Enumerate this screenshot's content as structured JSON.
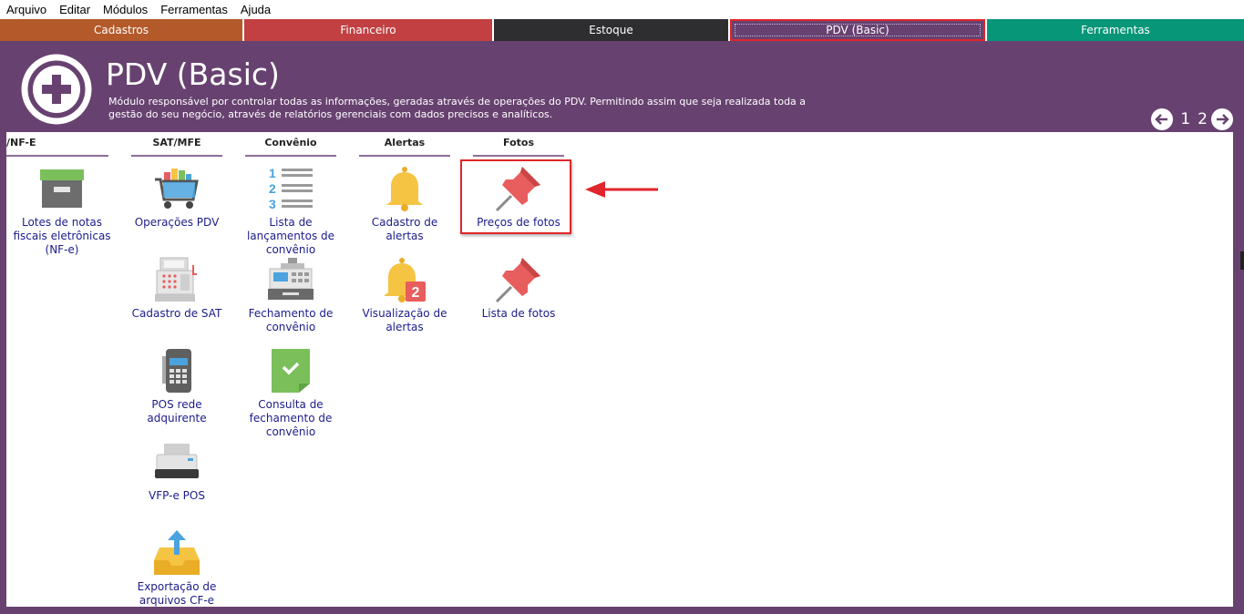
{
  "menu": [
    "Arquivo",
    "Editar",
    "Módulos",
    "Ferramentas",
    "Ajuda"
  ],
  "tabs": [
    {
      "label": "Cadastros",
      "color": "#b4592a"
    },
    {
      "label": "Financeiro",
      "color": "#c24042"
    },
    {
      "label": "Estoque",
      "color": "#2e2d2f"
    },
    {
      "label": "PDV (Basic)",
      "color": "#674270"
    },
    {
      "label": "Ferramentas",
      "color": "#079678"
    }
  ],
  "header": {
    "title": "PDV (Basic)",
    "description": "Módulo responsável por controlar todas as informações, geradas através de operações do PDV. Permitindo assim que seja realizada toda a gestão do seu negócio, através de relatórios gerenciais com dados precisos e analíticos.",
    "pages": [
      "1",
      "2"
    ]
  },
  "columns": [
    {
      "title": "/NF-E",
      "items": [
        "Lotes de notas fiscais eletrônicas (NF-e)"
      ]
    },
    {
      "title": "SAT/MFE",
      "items": [
        "Operações PDV",
        "Cadastro de SAT",
        "POS rede adquirente",
        "VFP-e POS",
        "Exportação de arquivos CF-e"
      ]
    },
    {
      "title": "Convênio",
      "items": [
        "Lista de lançamentos de convênio",
        "Fechamento de convênio",
        "Consulta de fechamento de convênio"
      ]
    },
    {
      "title": "Alertas",
      "items": [
        "Cadastro de alertas",
        "Visualização de alertas"
      ]
    },
    {
      "title": "Fotos",
      "items": [
        "Preços de fotos",
        "Lista de fotos"
      ]
    }
  ],
  "badge": "2",
  "colors": {
    "accent": "#674270",
    "highlight": "#e0262b"
  }
}
